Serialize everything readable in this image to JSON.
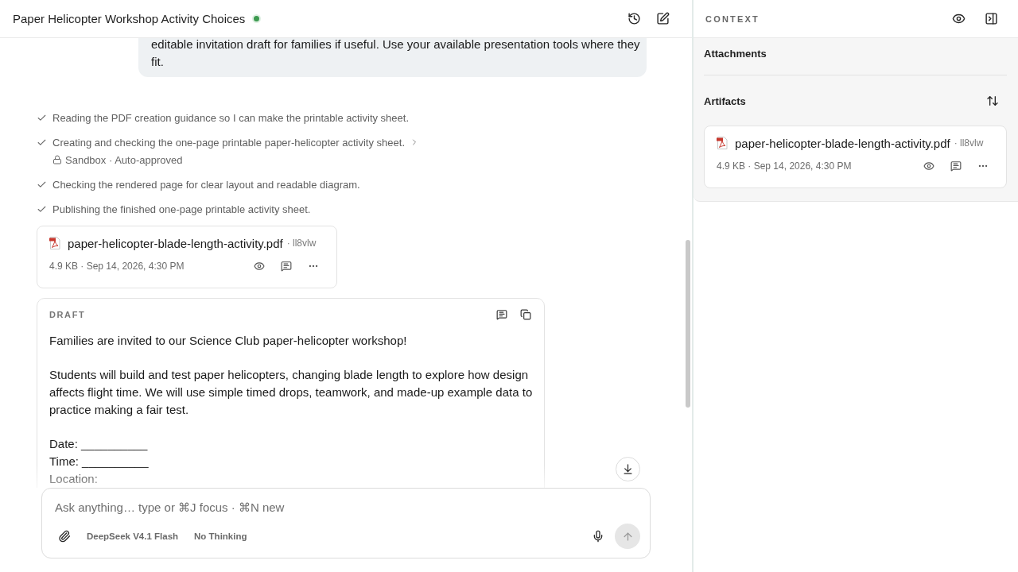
{
  "header": {
    "title": "Paper Helicopter Workshop Activity Choices",
    "connected": true
  },
  "message": {
    "text": "editable invitation draft for families if useful. Use your available presentation tools where they fit."
  },
  "steps": [
    {
      "text": "Reading the PDF creation guidance so I can make the printable activity sheet.",
      "done": true,
      "expandable": false
    },
    {
      "text": "Creating and checking the one-page printable paper-helicopter activity sheet.",
      "done": true,
      "expandable": true,
      "detail": "Sandbox · Auto-approved"
    },
    {
      "text": "Checking the rendered page for clear layout and readable diagram.",
      "done": true,
      "expandable": false
    },
    {
      "text": "Publishing the finished one-page printable activity sheet.",
      "done": true,
      "expandable": false
    }
  ],
  "artifact": {
    "filename": "paper-helicopter-blade-length-activity.pdf",
    "tag": "· ll8vlw",
    "details": "4.9 KB · Sep 14, 2026, 4:30 PM"
  },
  "draft": {
    "label": "DRAFT",
    "blocks": [
      [
        "Families are invited to our Science Club paper-helicopter workshop!"
      ],
      [
        "Students will build and test paper helicopters, changing blade length to explore how design affects flight time. We will use simple timed drops, teamwork, and made-up example data to practice making a fair test."
      ],
      [
        "Date: __________",
        "Time: __________",
        "Location:"
      ]
    ]
  },
  "composer": {
    "placeholder": "Ask anything… type or ⌘J focus · ⌘N new",
    "model": "DeepSeek V4.1 Flash",
    "thinking": "No Thinking",
    "send_disabled": true
  },
  "context": {
    "title": "CONTEXT",
    "attachments": {
      "heading": "Attachments"
    },
    "artifacts": {
      "heading": "Artifacts",
      "items": [
        {
          "filename": "paper-helicopter-blade-length-activity.pdf",
          "tag": "· ll8vlw",
          "details": "4.9 KB · Sep 14, 2026, 4:30 PM"
        }
      ]
    }
  }
}
